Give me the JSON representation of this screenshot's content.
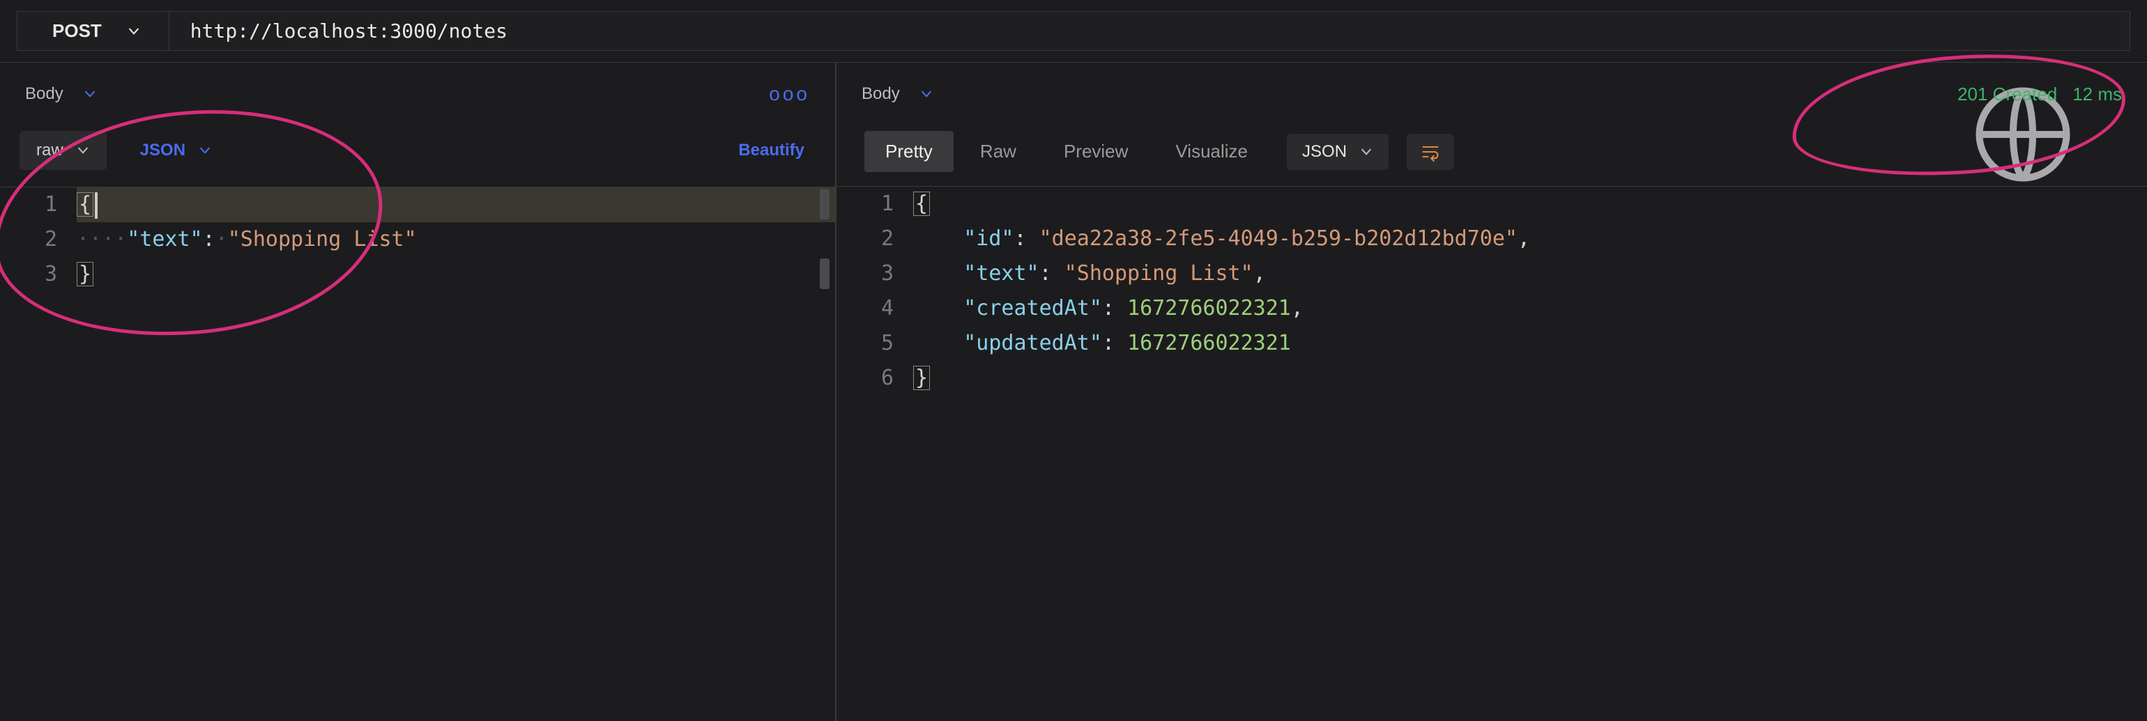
{
  "request": {
    "method": "POST",
    "url": "http://localhost:3000/notes"
  },
  "leftPanel": {
    "tabLabel": "Body",
    "bodySubtype": "raw",
    "language": "JSON",
    "beautifyLabel": "Beautify",
    "moreLabel": "ooo",
    "lines": {
      "n1": "1",
      "n2": "2",
      "n3": "3",
      "brace_open": "{",
      "key1": "\"text\"",
      "colon1": ":",
      "val1": "\"Shopping List\"",
      "brace_close": "}"
    }
  },
  "rightPanel": {
    "tabLabel": "Body",
    "status": "201 Created",
    "timing": "12 ms",
    "viewTabs": {
      "pretty": "Pretty",
      "raw": "Raw",
      "preview": "Preview",
      "visualize": "Visualize"
    },
    "formatLabel": "JSON",
    "lines": {
      "n1": "1",
      "n2": "2",
      "n3": "3",
      "n4": "4",
      "n5": "5",
      "n6": "6",
      "brace_open": "{",
      "k_id": "\"id\"",
      "v_id": "\"dea22a38-2fe5-4049-b259-b202d12bd70e\"",
      "k_text": "\"text\"",
      "v_text": "\"Shopping List\"",
      "k_created": "\"createdAt\"",
      "v_created": "1672766022321",
      "k_updated": "\"updatedAt\"",
      "v_updated": "1672766022321",
      "brace_close": "}",
      "colon": ":",
      "comma": ","
    }
  }
}
